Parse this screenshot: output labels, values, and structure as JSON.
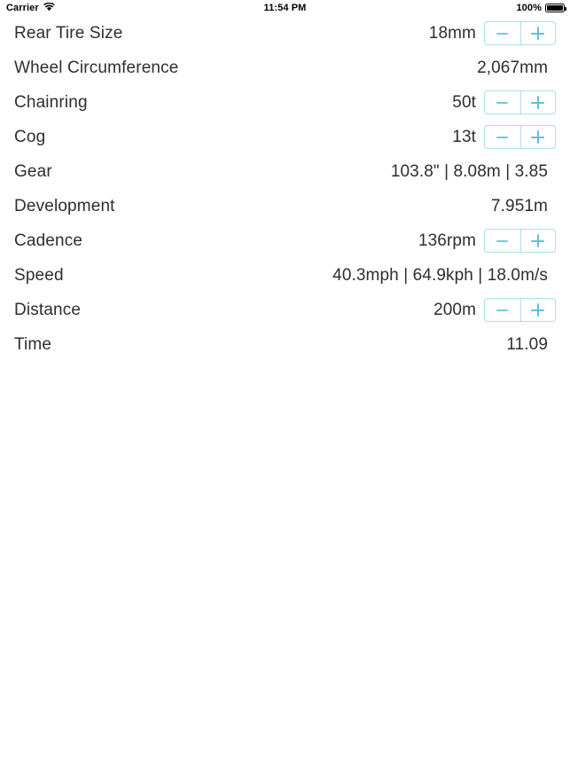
{
  "status_bar": {
    "carrier": "Carrier",
    "wifi_icon": "wifi-icon",
    "time": "11:54 PM",
    "battery_percent": "100%",
    "battery_icon": "battery-full-icon"
  },
  "stepper": {
    "minus_label": "−",
    "plus_label": "+",
    "border_color": "#aedcf0",
    "glyph_color": "#5dbfe6"
  },
  "rows": [
    {
      "label": "Rear Tire Size",
      "value": "18mm",
      "stepper": true
    },
    {
      "label": "Wheel Circumference",
      "value": "2,067mm",
      "stepper": false
    },
    {
      "label": "Chainring",
      "value": "50t",
      "stepper": true
    },
    {
      "label": "Cog",
      "value": "13t",
      "stepper": true
    },
    {
      "label": "Gear",
      "value": "103.8\" | 8.08m | 3.85",
      "stepper": false
    },
    {
      "label": "Development",
      "value": "7.951m",
      "stepper": false
    },
    {
      "label": "Cadence",
      "value": "136rpm",
      "stepper": true
    },
    {
      "label": "Speed",
      "value": "40.3mph | 64.9kph | 18.0m/s",
      "stepper": false
    },
    {
      "label": "Distance",
      "value": "200m",
      "stepper": true
    },
    {
      "label": "Time",
      "value": "11.09",
      "stepper": false
    }
  ]
}
